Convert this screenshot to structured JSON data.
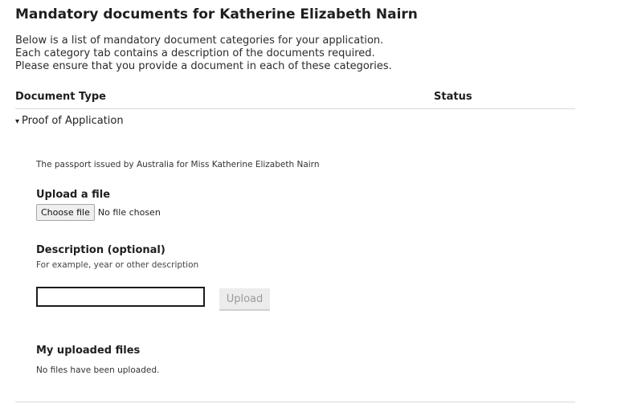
{
  "page": {
    "title": "Mandatory documents for Katherine Elizabeth Nairn",
    "intro_lines": [
      "Below is a list of mandatory document categories for your application.",
      "Each category tab contains a description of the documents required.",
      "Please ensure that you provide a document in each of these categories."
    ]
  },
  "table": {
    "col_document_type": "Document Type",
    "col_status": "Status"
  },
  "category": {
    "caret_icon": "▾",
    "label": "Proof of Application",
    "description": "The passport issued by Australia for Miss Katherine Elizabeth Nairn"
  },
  "upload": {
    "heading": "Upload a file",
    "choose_button": "Choose file",
    "no_file_text": "No file chosen",
    "description_heading": "Description (optional)",
    "description_hint": "For example, year or other description",
    "description_value": "",
    "upload_button": "Upload"
  },
  "uploaded": {
    "heading": "My uploaded files",
    "empty_text": "No files have been uploaded."
  }
}
